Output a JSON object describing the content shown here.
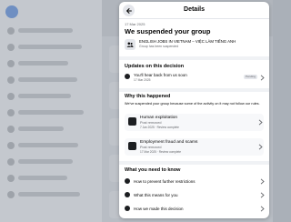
{
  "dialog": {
    "title": "Details",
    "date": "17 Mar 2025",
    "heading": "We suspended your group",
    "group": {
      "name": "ENGLISH JOBS IN VIETNAM – VIỆC LÀM TIẾNG ANH",
      "status": "Group has been suspended"
    }
  },
  "updates": {
    "title": "Updates on this decision",
    "item": {
      "text": "You'll hear back from us soon",
      "date": "17 Mar 2025",
      "badge": "Pending"
    }
  },
  "why": {
    "title": "Why this happened",
    "description": "We've suspended your group because some of the activity on it may not follow our rules.",
    "reasons": [
      {
        "title": "Human exploitation",
        "status": "Post removed",
        "date": "7 Jan 2025 · Review complete"
      },
      {
        "title": "Employment fraud and scams",
        "status": "Post removed",
        "date": "17 Mar 2025 · Review complete"
      }
    ]
  },
  "know": {
    "title": "What you need to know",
    "items": [
      {
        "label": "How to prevent further restrictions"
      },
      {
        "label": "What this means for you"
      },
      {
        "label": "How we made this decision"
      }
    ]
  }
}
